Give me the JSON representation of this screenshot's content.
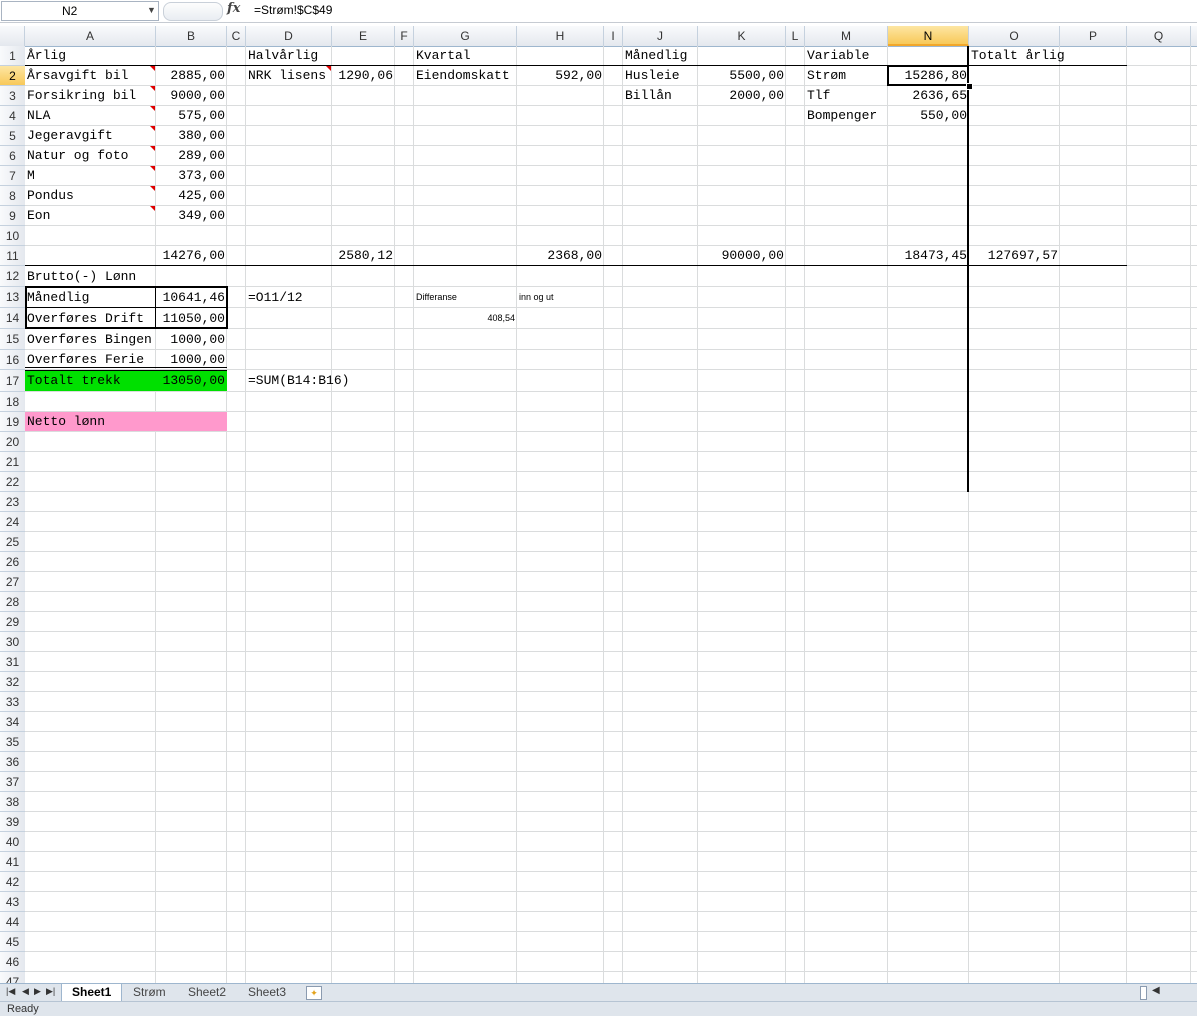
{
  "formula_bar": {
    "name_box": "N2",
    "fx_label": "fx",
    "formula": "=Strøm!$C$49"
  },
  "columns": [
    "A",
    "B",
    "C",
    "D",
    "E",
    "F",
    "G",
    "H",
    "I",
    "J",
    "K",
    "L",
    "M",
    "N",
    "O",
    "P",
    "Q",
    "R"
  ],
  "selected_column": "N",
  "rows": [
    "1",
    "2",
    "3",
    "4",
    "5",
    "6",
    "7",
    "8",
    "9",
    "10",
    "11",
    "12",
    "13",
    "14",
    "15",
    "16",
    "17",
    "18",
    "19",
    "20",
    "21",
    "22",
    "23",
    "24",
    "25",
    "26",
    "27",
    "28",
    "29",
    "30",
    "31",
    "32",
    "33",
    "34",
    "35",
    "36",
    "37",
    "38",
    "39",
    "40",
    "41",
    "42",
    "43",
    "44",
    "45",
    "46",
    "47"
  ],
  "selected_row": "2",
  "cells": {
    "A1": "Årlig",
    "D1": "Halvårlig",
    "G1": "Kvartal",
    "J1": "Månedlig",
    "M1": "Variable",
    "O1": "Totalt årlig",
    "A2": "Årsavgift bil",
    "B2": "2885,00",
    "D2": "NRK lisens",
    "E2": "1290,06",
    "G2": "Eiendomskatt",
    "H2": "592,00",
    "J2": "Husleie",
    "K2": "5500,00",
    "M2": "Strøm",
    "N2": "15286,80",
    "A3": "Forsikring bil",
    "B3": "9000,00",
    "J3": "Billån",
    "K3": "2000,00",
    "M3": "Tlf",
    "N3": "2636,65",
    "A4": "NLA",
    "B4": "575,00",
    "M4": "Bompenger",
    "N4": "550,00",
    "A5": "Jegeravgift",
    "B5": "380,00",
    "A6": "Natur og foto",
    "B6": "289,00",
    "A7": "M",
    "B7": "373,00",
    "A8": "Pondus",
    "B8": "425,00",
    "A9": "Eon",
    "B9": "349,00",
    "B11": "14276,00",
    "E11": "2580,12",
    "H11": "2368,00",
    "K11": "90000,00",
    "N11": "18473,45",
    "O11": "127697,57",
    "A12": "Brutto(-) Lønn",
    "A13": "Månedlig",
    "B13": "10641,46",
    "D13": "=O11/12",
    "G13": "Differanse",
    "H13": "inn og ut",
    "A14": "Overføres Drift",
    "B14": "11050,00",
    "G14": "408,54",
    "A15": "Overføres Bingen",
    "B15": "1000,00",
    "A16": "Overføres Ferie",
    "B16": "1000,00",
    "A17": "Totalt trekk",
    "B17": "13050,00",
    "D17": "=SUM(B14:B16)",
    "A19": "Netto lønn"
  },
  "sheet_tabs": [
    "Sheet1",
    "Strøm",
    "Sheet2",
    "Sheet3"
  ],
  "active_tab": "Sheet1",
  "status": "Ready",
  "colors": {
    "green_fill": "#00e000",
    "pink_fill": "#ff99cc",
    "comment_marker": "#e00000",
    "selection_header": "#f8c95a"
  }
}
